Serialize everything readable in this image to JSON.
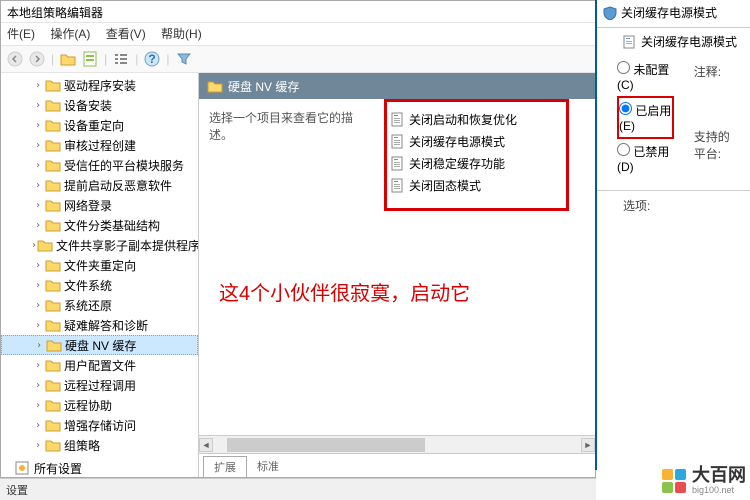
{
  "window": {
    "title": "本地组策略编辑器",
    "menus": [
      "件(E)",
      "操作(A)",
      "查看(V)",
      "帮助(H)"
    ]
  },
  "tree": [
    "驱动程序安装",
    "设备安装",
    "设备重定向",
    "审核过程创建",
    "受信任的平台模块服务",
    "提前启动反恶意软件",
    "网络登录",
    "文件分类基础结构",
    "文件共享影子副本提供程序",
    "文件夹重定向",
    "文件系统",
    "系统还原",
    "疑难解答和诊断",
    "硬盘 NV 缓存",
    "用户配置文件",
    "远程过程调用",
    "远程协助",
    "增强存储访问",
    "组策略"
  ],
  "tree_selected_index": 13,
  "all_settings": "所有设置",
  "content": {
    "header": "硬盘 NV 缓存",
    "description": "选择一个项目来查看它的描述。",
    "items": [
      "关闭启动和恢复优化",
      "关闭缓存电源模式",
      "关闭稳定缓存功能",
      "关闭固态模式"
    ]
  },
  "annotation": "这4个小伙伴很寂寞，启动它",
  "tabs": [
    "扩展",
    "标准"
  ],
  "statusbar": "设置",
  "right": {
    "title_header": "关闭缓存电源模式",
    "sub": "关闭缓存电源模式",
    "opts": [
      {
        "label": "未配置(C)",
        "sel": false
      },
      {
        "label": "已启用(E)",
        "sel": true
      },
      {
        "label": "已禁用(D)",
        "sel": false
      }
    ],
    "extra1": "注释:",
    "extra2": "支持的平台:",
    "section": "选项:"
  },
  "logo": {
    "cn": "大百网",
    "en": "big100.net"
  }
}
